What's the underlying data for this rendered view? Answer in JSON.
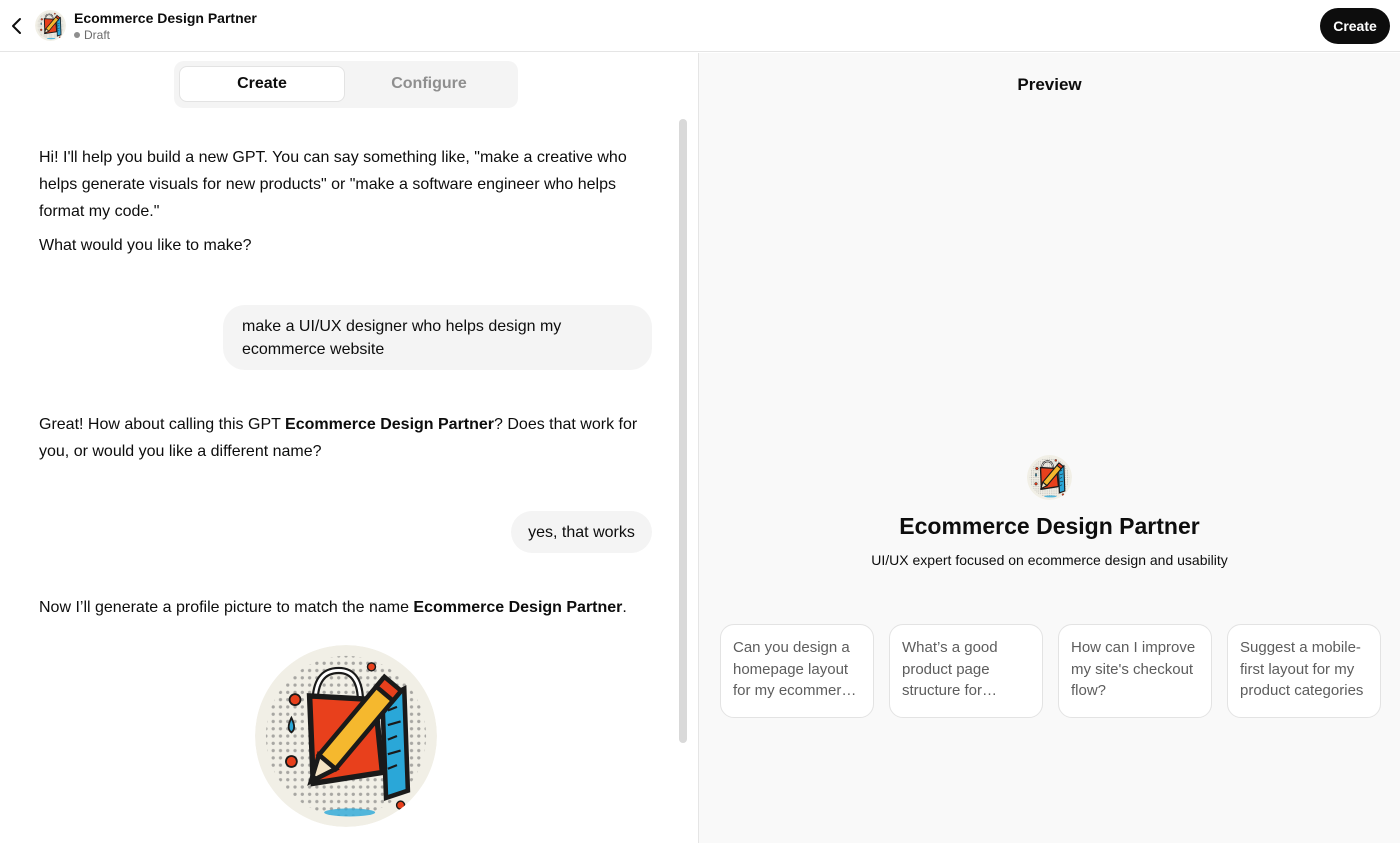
{
  "header": {
    "title": "Ecommerce Design Partner",
    "status": "Draft",
    "create_label": "Create"
  },
  "tabs": [
    {
      "label": "Create",
      "active": true
    },
    {
      "label": "Configure",
      "active": false
    }
  ],
  "chat": {
    "intro_line1": "Hi! I'll help you build a new GPT. You can say something like, \"make a creative who helps generate visuals for new products\" or \"make a software engineer who helps format my code.\"",
    "intro_line2": "What would you like to make?",
    "user_msg_1": "make a UI/UX designer who helps design my ecommerce website",
    "reply_2_before": "Great! How about calling this GPT ",
    "reply_2_name": "Ecommerce Design Partner",
    "reply_2_after": "? Does that work for you, or would you like a different name?",
    "user_msg_2": "yes, that works",
    "reply_3_before": "Now I’ll generate a profile picture to match the name ",
    "reply_3_name": "Ecommerce Design Partner",
    "reply_3_after": "."
  },
  "preview": {
    "label": "Preview",
    "name": "Ecommerce Design Partner",
    "description": "UI/UX expert focused on ecommerce design and usability",
    "starters": [
      "Can you design a homepage layout for my ecommerce site?",
      "What’s a good product page structure for ecommerce?",
      "How can I improve my site's checkout flow?",
      "Suggest a mobile-first layout for my product categories"
    ]
  },
  "icons": {
    "back": "chevron-left-icon",
    "avatar": "shopping-bag-pencil-ruler-icon"
  },
  "colors": {
    "accent": "#0d0d0d",
    "bag_red": "#e8401c",
    "ruler_blue": "#2aa7d8",
    "pencil_yellow": "#f5b82e"
  }
}
